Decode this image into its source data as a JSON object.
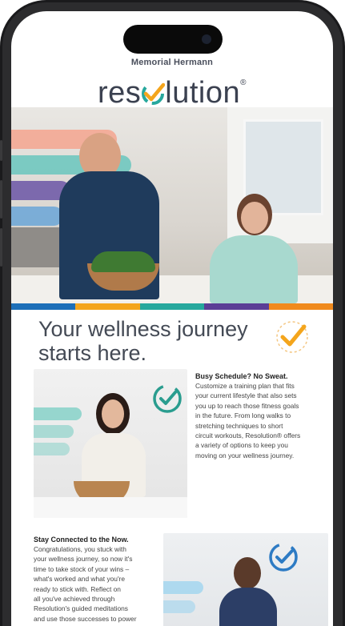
{
  "brand": {
    "parent": "Memorial Hermann",
    "logo_left": "res",
    "logo_right": "lution",
    "logo_mark": "®"
  },
  "colors": {
    "bar": [
      "#1d6fb8",
      "#f4a51c",
      "#27a89d",
      "#5b3e96",
      "#f08a1d"
    ],
    "check_orange": "#f4a51c",
    "check_teal": "#2a9d8f",
    "check_blue": "#2d7bc4",
    "headline": "#444a55"
  },
  "headline": {
    "line1": "Your wellness journey",
    "line2": "starts here."
  },
  "section1": {
    "title": "Busy Schedule? No Sweat.",
    "lines": [
      "Customize a training plan that fits",
      "your current lifestyle that also sets",
      "you up to reach those fitness goals",
      "in the future. From long walks to",
      "stretching techniques to short",
      "circuit workouts, Resolution® offers",
      "a variety of options to keep you",
      "moving on your wellness journey."
    ]
  },
  "section2": {
    "title": "Stay Connected to the Now.",
    "lines": [
      "Congratulations, you stuck with",
      "your wellness journey, so now it's",
      "time to take stock of your wins –",
      "what's worked and what you're",
      "ready to stick with. Reflect on",
      "all you've achieved through",
      "Resolution's guided meditations",
      "and use those successes to power"
    ]
  },
  "icons": {
    "hero_check": "orange-check-icon",
    "card1_check": "teal-check-badge-icon",
    "card2_check": "blue-check-badge-icon"
  }
}
